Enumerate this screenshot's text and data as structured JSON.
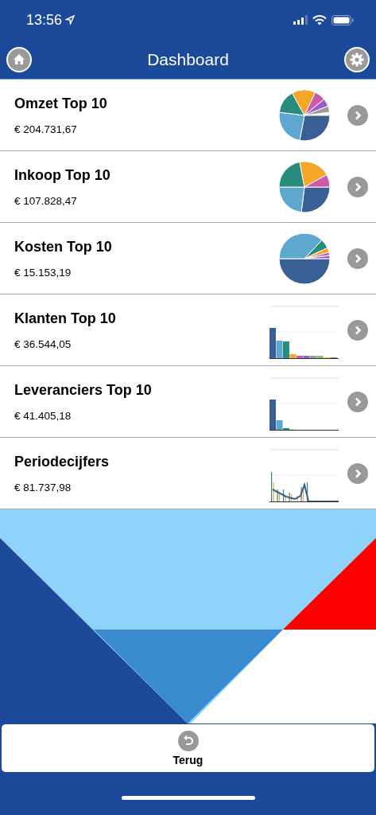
{
  "status_bar": {
    "time": "13:56"
  },
  "header": {
    "title": "Dashboard"
  },
  "items": [
    {
      "title": "Omzet Top 10",
      "amount": "€ 204.731,67",
      "kind": "pie"
    },
    {
      "title": "Inkoop Top 10",
      "amount": "€ 107.828,47",
      "kind": "pie"
    },
    {
      "title": "Kosten Top 10",
      "amount": "€ 15.153,19",
      "kind": "pie"
    },
    {
      "title": "Klanten Top 10",
      "amount": "€ 36.544,05",
      "kind": "bar"
    },
    {
      "title": "Leveranciers Top 10",
      "amount": "€ 41.405,18",
      "kind": "bar"
    },
    {
      "title": "Periodecijfers",
      "amount": "€ 81.737,98",
      "kind": "line"
    }
  ],
  "footer": {
    "back_label": "Terug"
  }
}
